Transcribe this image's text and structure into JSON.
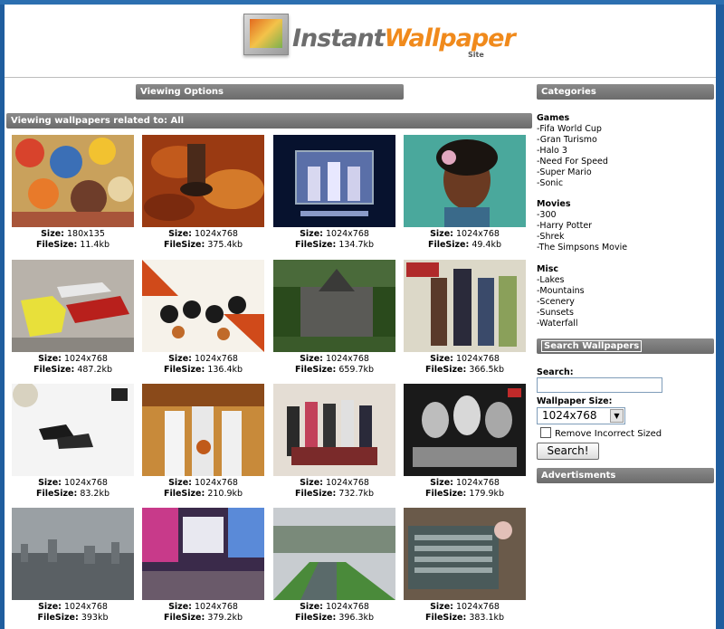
{
  "header": {
    "logo_part1": "Instant",
    "logo_part2": "Wallpaper",
    "logo_sub": "Site"
  },
  "viewing_options_label": "Viewing Options",
  "related_label": "Viewing wallpapers related to: All",
  "size_label": "Size:",
  "filesize_label": "FileSize:",
  "wallpapers": [
    {
      "size": "180x135",
      "filesize": "11.4kb",
      "scene": "cartoon-collage"
    },
    {
      "size": "1024x768",
      "filesize": "375.4kb",
      "scene": "autumn-leaves"
    },
    {
      "size": "1024x768",
      "filesize": "134.7kb",
      "scene": "weird-sisters"
    },
    {
      "size": "1024x768",
      "filesize": "49.4kb",
      "scene": "painted-woman"
    },
    {
      "size": "1024x768",
      "filesize": "487.2kb",
      "scene": "toy-cars"
    },
    {
      "size": "1024x768",
      "filesize": "136.4kb",
      "scene": "adidas-basketball"
    },
    {
      "size": "1024x768",
      "filesize": "659.7kb",
      "scene": "church"
    },
    {
      "size": "1024x768",
      "filesize": "366.5kb",
      "scene": "death-cast"
    },
    {
      "size": "1024x768",
      "filesize": "83.2kb",
      "scene": "soccer-shoes"
    },
    {
      "size": "1024x768",
      "filesize": "210.9kb",
      "scene": "cavaliers"
    },
    {
      "size": "1024x768",
      "filesize": "732.7kb",
      "scene": "group-photo"
    },
    {
      "size": "1024x768",
      "filesize": "179.9kb",
      "scene": "bw-women"
    },
    {
      "size": "1024x768",
      "filesize": "393kb",
      "scene": "city-haze"
    },
    {
      "size": "1024x768",
      "filesize": "379.2kb",
      "scene": "neon-street"
    },
    {
      "size": "1024x768",
      "filesize": "396.3kb",
      "scene": "canal"
    },
    {
      "size": "1024x768",
      "filesize": "383.1kb",
      "scene": "radiator"
    }
  ],
  "sidebar": {
    "categories_label": "Categories",
    "groups": [
      {
        "title": "Games",
        "items": [
          "-Fifa World Cup",
          "-Gran Turismo",
          "-Halo 3",
          "-Need For Speed",
          "-Super Mario",
          "-Sonic"
        ]
      },
      {
        "title": "Movies",
        "items": [
          "-300",
          "-Harry Potter",
          "-Shrek",
          "-The Simpsons Movie"
        ]
      },
      {
        "title": "Misc",
        "items": [
          "-Lakes",
          "-Mountains",
          "-Scenery",
          "-Sunsets",
          "-Waterfall"
        ]
      }
    ],
    "search_wallpapers_label": "Search Wallpapers",
    "search_label": "Search:",
    "search_value": "",
    "wallpaper_size_label": "Wallpaper Size:",
    "wallpaper_size_selected": "1024x768",
    "remove_incorrect_label": "Remove Incorrect Sized",
    "search_button_label": "Search!",
    "advertisments_label": "Advertisments"
  },
  "colors": {
    "outer_frame": "#1f5d9e",
    "bar_gray": "#787878",
    "logo_gray": "#6d6d6d",
    "logo_orange": "#f08a1c"
  }
}
